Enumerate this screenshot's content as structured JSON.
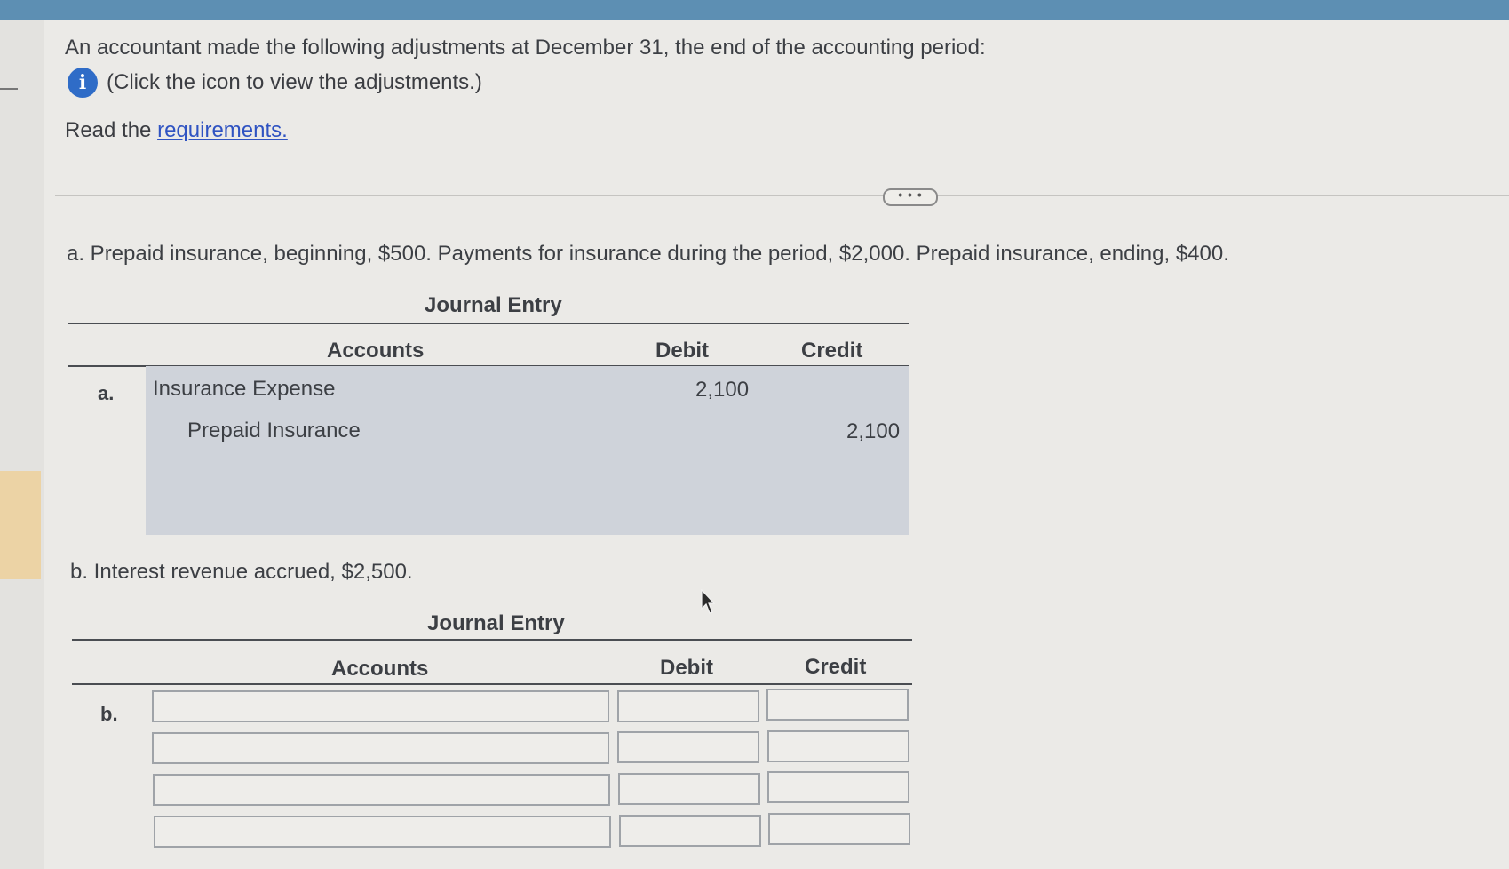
{
  "question": {
    "text": "An accountant made the following adjustments at December 31, the end of the accounting period:",
    "info_text": "(Click the icon to view the adjustments.)",
    "info_icon": "info-icon",
    "read_prefix": "Read the",
    "requirements_link": "requirements."
  },
  "more_button": "• • •",
  "part_a": {
    "text": "a. Prepaid insurance, beginning, $500. Payments for insurance during the period, $2,000. Prepaid insurance, ending, $400.",
    "journal_title": "Journal Entry",
    "headers": {
      "accounts": "Accounts",
      "debit": "Debit",
      "credit": "Credit"
    },
    "row_letter": "a.",
    "rows": [
      {
        "account": "Insurance Expense",
        "debit": "2,100",
        "credit": ""
      },
      {
        "account": "Prepaid Insurance",
        "debit": "",
        "credit": "2,100"
      }
    ]
  },
  "part_b": {
    "text": "b. Interest revenue accrued, $2,500.",
    "journal_title": "Journal Entry",
    "headers": {
      "accounts": "Accounts",
      "debit": "Debit",
      "credit": "Credit"
    },
    "row_letter": "b.",
    "rows": [
      {
        "account": "",
        "debit": "",
        "credit": ""
      },
      {
        "account": "",
        "debit": "",
        "credit": ""
      },
      {
        "account": "",
        "debit": "",
        "credit": ""
      },
      {
        "account": "",
        "debit": "",
        "credit": ""
      }
    ]
  },
  "colors": {
    "top_bar": "#5d8fb3",
    "info_icon": "#2f6cc7",
    "link": "#2f53c2",
    "filled_entry_bg": "#cfd3da"
  }
}
